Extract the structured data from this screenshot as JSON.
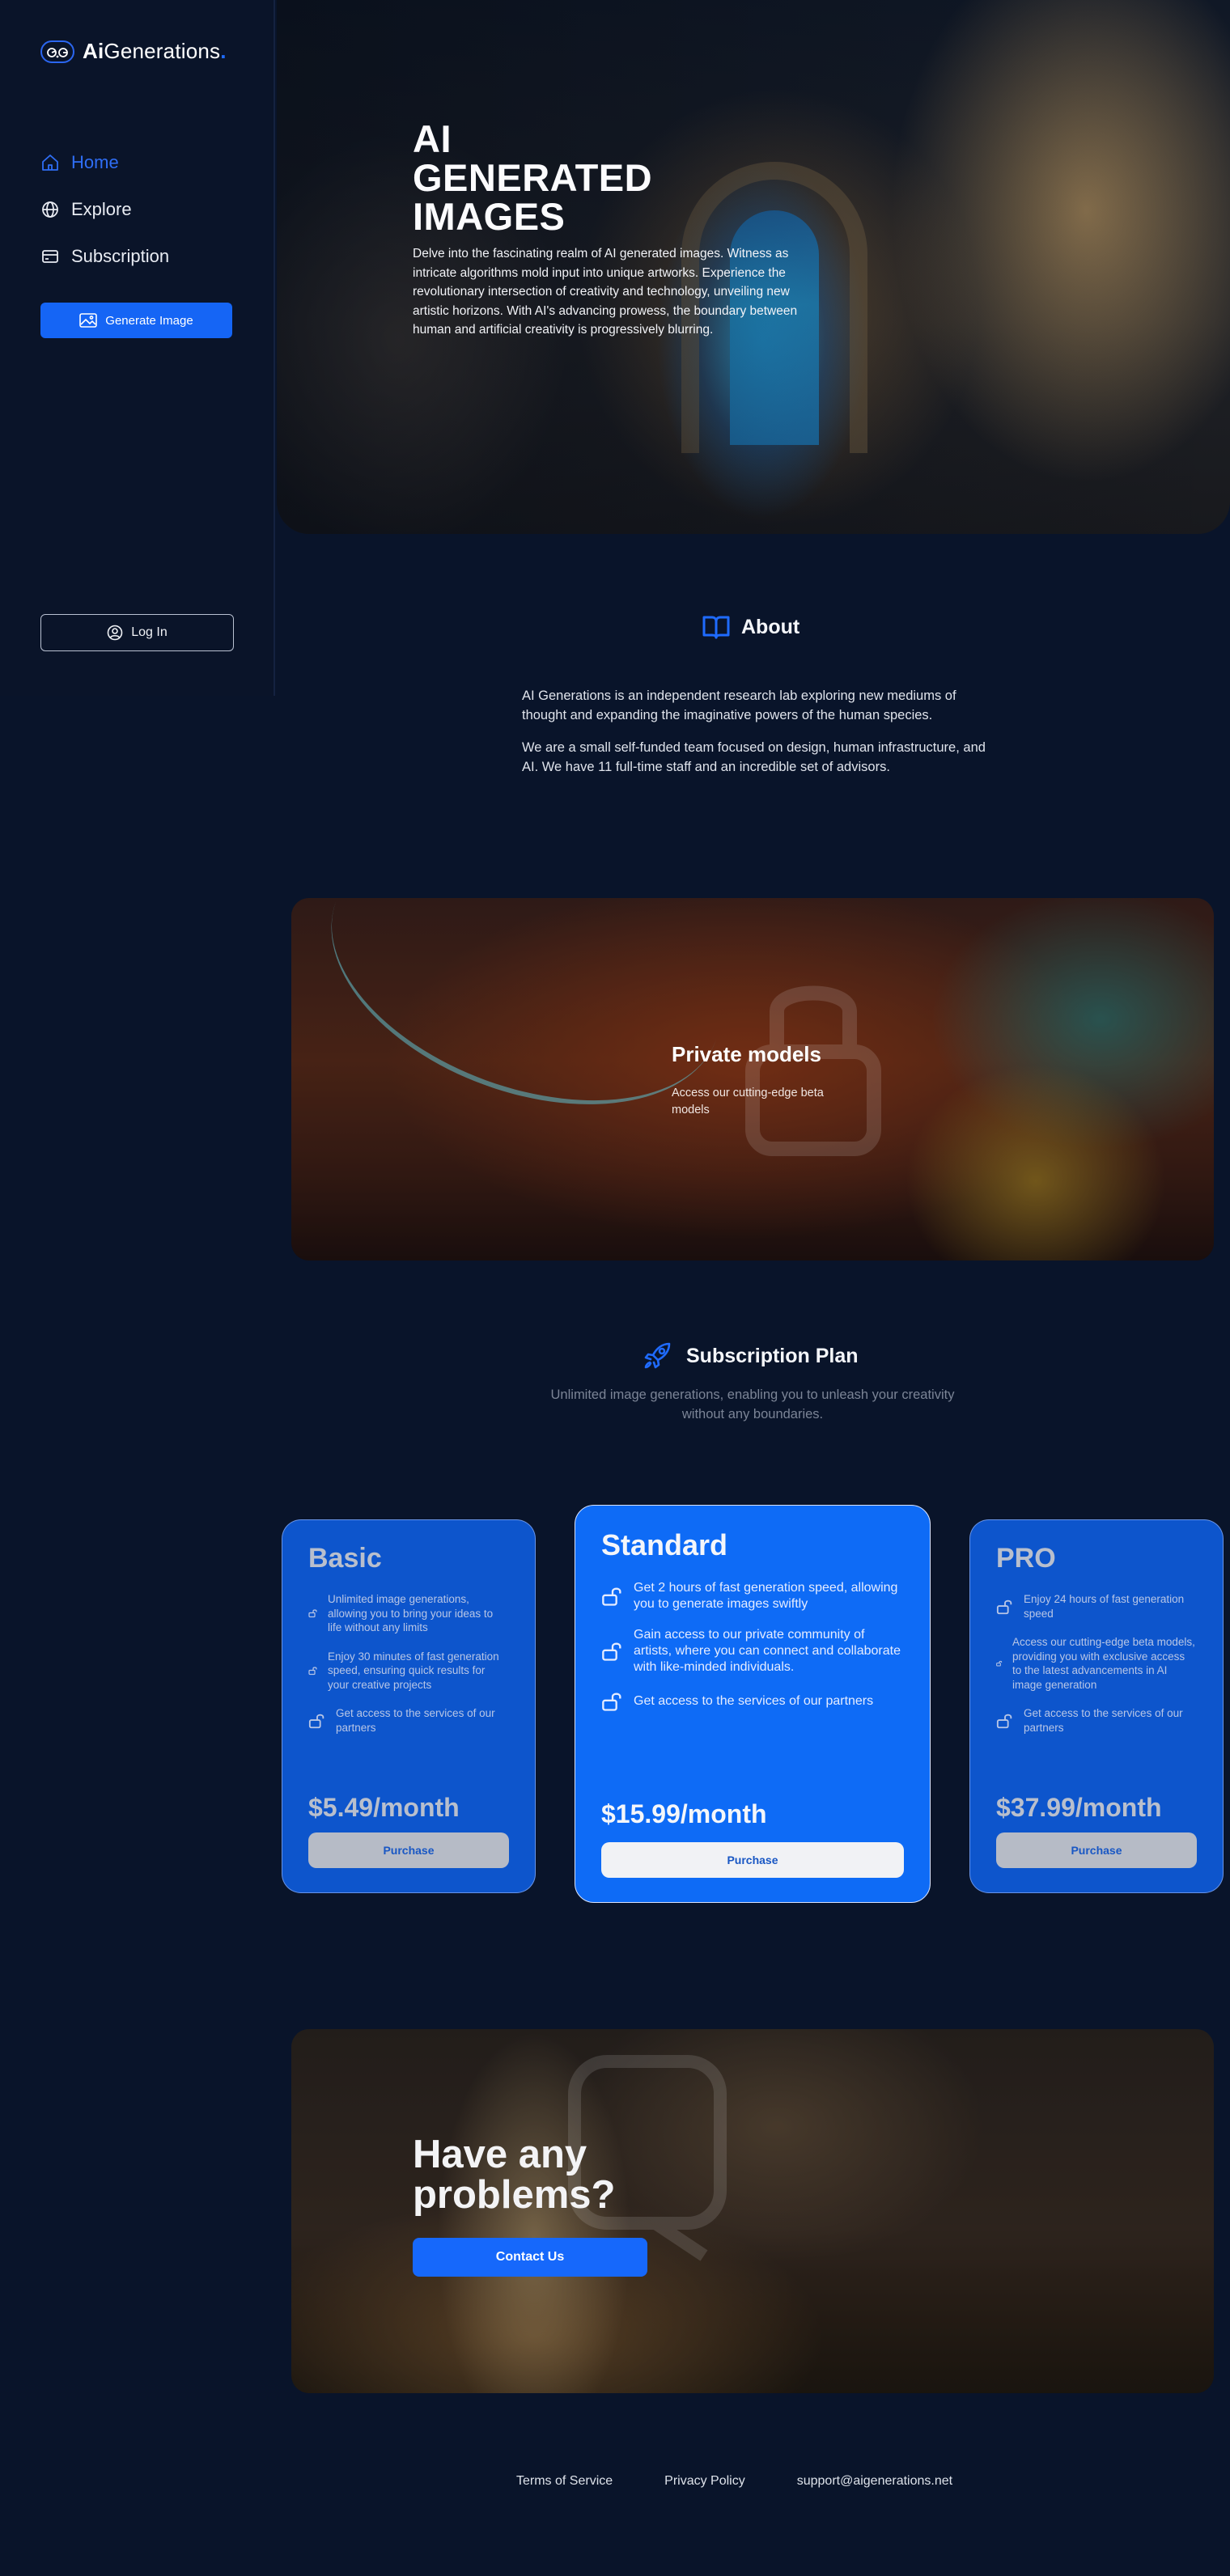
{
  "brand": {
    "logo_ai": "Ai",
    "logo_rest": "Generations",
    "logo_dot": ".",
    "accent_color": "#1565f5"
  },
  "sidebar": {
    "nav": [
      {
        "label": "Home",
        "icon": "home-icon",
        "active": true
      },
      {
        "label": "Explore",
        "icon": "globe-icon",
        "active": false
      },
      {
        "label": "Subscription",
        "icon": "credit-card-icon",
        "active": false
      }
    ],
    "generate_button": "Generate Image",
    "login_button": "Log In"
  },
  "hero": {
    "title_lines": [
      "AI",
      "GENERATED",
      "IMAGES"
    ],
    "description": "Delve into the fascinating realm of AI generated images. Witness as intricate algorithms mold input into unique artworks. Experience the revolutionary intersection of creativity and technology, unveiling new artistic horizons. With AI's advancing prowess, the boundary between human and artificial creativity is progressively blurring."
  },
  "about": {
    "title": "About",
    "paragraphs": [
      "AI Generations is an independent research lab exploring new mediums of thought and expanding the imaginative powers of the human species.",
      "We are a small self-funded team focused on design, human infrastructure, and AI. We have 11 full-time staff and an incredible set of advisors."
    ]
  },
  "private_models": {
    "title": "Private models",
    "description": "Access our cutting-edge beta models"
  },
  "subscription": {
    "title": "Subscription Plan",
    "description": "Unlimited image generations, enabling you to unleash your creativity without any boundaries.",
    "plans": [
      {
        "name": "Basic",
        "features": [
          "Unlimited image generations, allowing you to bring your ideas to life without any limits",
          "Enjoy 30 minutes of fast generation speed, ensuring quick results for your creative projects",
          "Get access to the services of our partners"
        ],
        "price": "$5.49/month",
        "button": "Purchase",
        "highlighted": false
      },
      {
        "name": "Standard",
        "features": [
          "Get 2 hours of fast generation speed, allowing you to generate images swiftly",
          "Gain access to our private community of artists, where you can connect and collaborate with like-minded individuals.",
          "Get access to the services of our partners"
        ],
        "price": "$15.99/month",
        "button": "Purchase",
        "highlighted": true
      },
      {
        "name": "PRO",
        "features": [
          "Enjoy 24 hours of fast generation speed",
          "Access our cutting-edge beta models, providing you with exclusive access to the latest advancements in AI image generation",
          "Get access to the services of our partners"
        ],
        "price": "$37.99/month",
        "button": "Purchase",
        "highlighted": false
      }
    ]
  },
  "contact": {
    "title": "Have any problems?",
    "button": "Contact Us"
  },
  "footer": {
    "links": [
      "Terms of Service",
      "Privacy Policy",
      "support@aigenerations.net"
    ]
  }
}
